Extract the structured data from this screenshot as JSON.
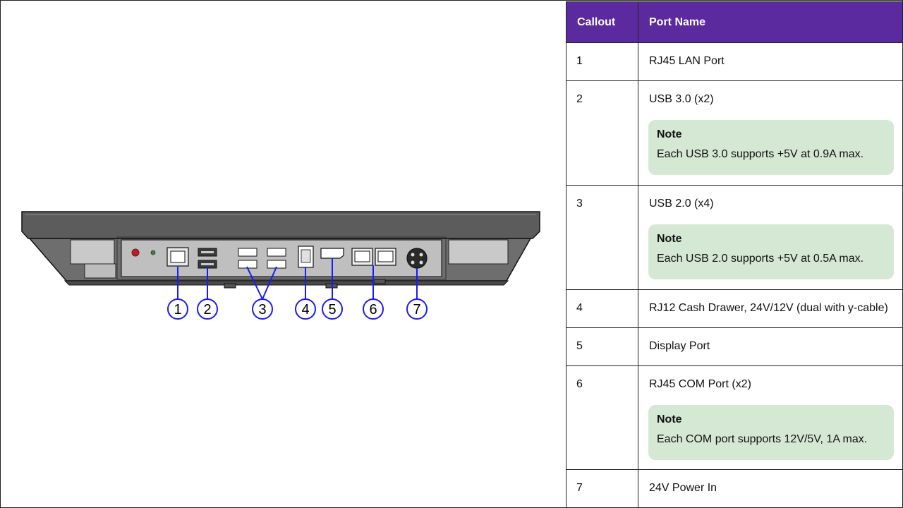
{
  "table": {
    "headers": {
      "callout": "Callout",
      "port_name": "Port Name"
    },
    "rows": [
      {
        "callout": "1",
        "name": "RJ45 LAN Port"
      },
      {
        "callout": "2",
        "name": "USB 3.0 (x2)",
        "note_title": "Note",
        "note_text": "Each USB 3.0 supports +5V at 0.9A max."
      },
      {
        "callout": "3",
        "name": "USB 2.0 (x4)",
        "note_title": "Note",
        "note_text": "Each USB 2.0 supports +5V at 0.5A max."
      },
      {
        "callout": "4",
        "name": "RJ12 Cash Drawer, 24V/12V (dual with y-cable)"
      },
      {
        "callout": "5",
        "name": "Display Port"
      },
      {
        "callout": "6",
        "name": "RJ45 COM Port (x2)",
        "note_title": "Note",
        "note_text": "Each COM port supports 12V/5V, 1A max."
      },
      {
        "callout": "7",
        "name": "24V Power In"
      }
    ]
  },
  "figure": {
    "callouts": [
      "1",
      "2",
      "3",
      "4",
      "5",
      "6",
      "7"
    ],
    "colors": {
      "callout_blue": "#1a1aff",
      "header_purple": "#5b2a9e",
      "note_green": "#d5e8d4",
      "device_gray": "#6e6e6e"
    }
  }
}
